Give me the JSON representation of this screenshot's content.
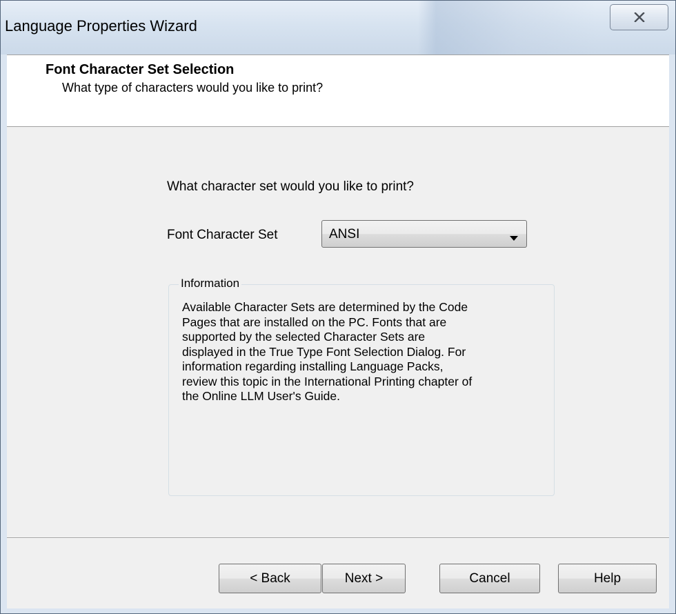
{
  "window": {
    "title": "Language Properties Wizard",
    "close_icon": "close-icon"
  },
  "header": {
    "title": "Font Character Set Selection",
    "subtitle": "What type of characters would you like to print?"
  },
  "content": {
    "question": "What character set would you like to print?",
    "font_charset_label": "Font Character Set",
    "font_charset_value": "ANSI",
    "font_charset_arrow_icon": "dropdown-arrow-icon"
  },
  "information": {
    "legend": "Information",
    "text": "Available Character Sets are determined by the Code\nPages that are installed on the PC.  Fonts that are\nsupported by the selected Character Sets are\ndisplayed in the True Type Font Selection Dialog.  For\ninformation regarding installing Language Packs,\nreview this topic in the International Printing chapter of\nthe Online LLM User's Guide."
  },
  "buttons": {
    "back": "< Back",
    "next": "Next >",
    "cancel": "Cancel",
    "help": "Help"
  }
}
